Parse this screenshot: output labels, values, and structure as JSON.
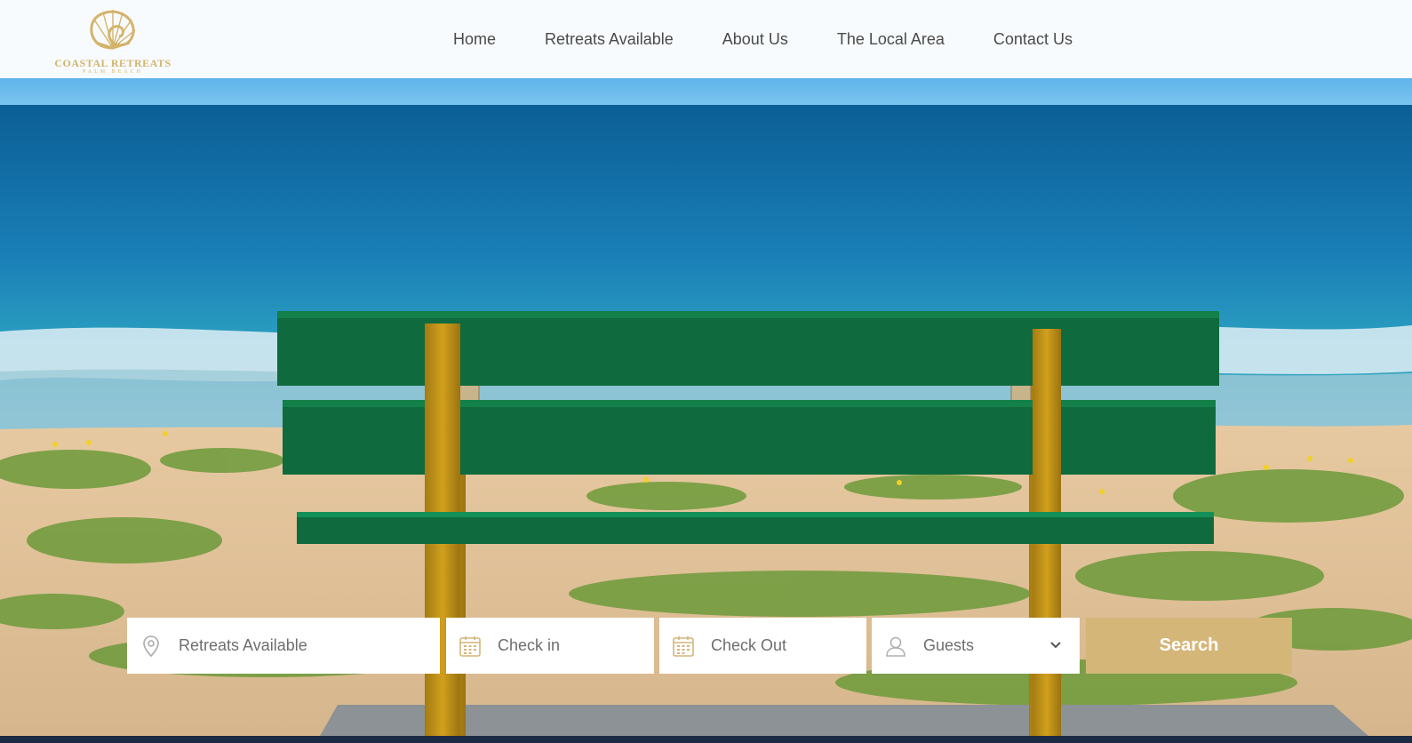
{
  "brand": {
    "name": "COASTAL RETREATS",
    "sub": "PALM BEACH",
    "logo_icon": "nautilus-shell-icon",
    "gold": "#d4b36b"
  },
  "nav": {
    "items": [
      "Home",
      "Retreats Available",
      "About Us",
      "The Local Area",
      "Contact Us"
    ]
  },
  "hero": {
    "image": "ocean-view-green-bench-photo"
  },
  "search": {
    "retreat": {
      "placeholder": "Retreats Available",
      "icon": "map-pin-icon"
    },
    "check_in": {
      "placeholder": "Check in",
      "icon": "calendar-icon"
    },
    "check_out": {
      "placeholder": "Check Out",
      "icon": "calendar-icon"
    },
    "guests": {
      "value": "Guests",
      "icon": "user-icon",
      "dropdown_icon": "chevron-down-icon"
    },
    "button_label": "Search",
    "button_color": "#d4b678"
  }
}
